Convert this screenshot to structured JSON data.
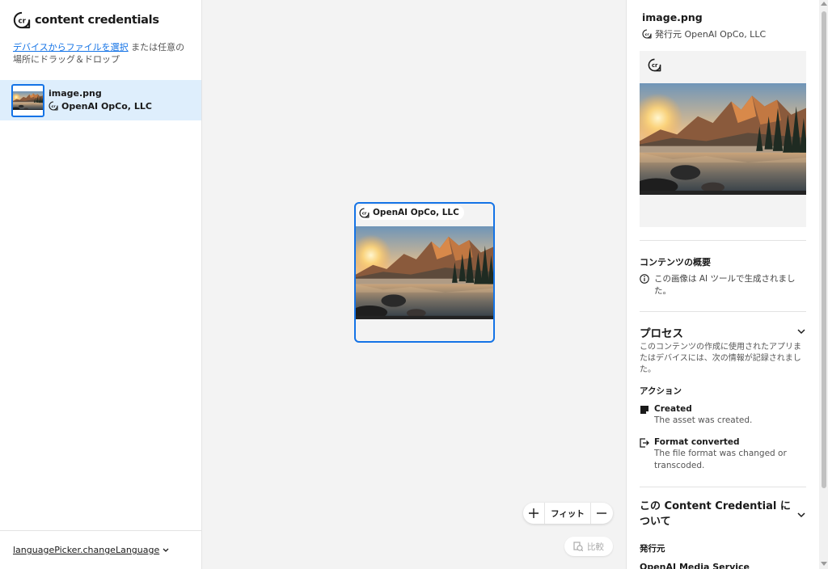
{
  "app": {
    "logo_text": "content credentials"
  },
  "sidebar": {
    "intro_link": "デバイスからファイルを選択",
    "intro_rest": " または任意の場所にドラッグ＆ドロップ",
    "file": {
      "name": "image.png",
      "issuer": "OpenAI OpCo, LLC"
    },
    "language_button": "languagePicker.changeLanguage"
  },
  "canvas": {
    "card_label": "OpenAI OpCo, LLC",
    "zoom_in": "+",
    "fit_label": "フィット",
    "zoom_out": "—",
    "compare_label": "比較"
  },
  "panel": {
    "title": "image.png",
    "issuer_line": "発行元 OpenAI OpCo, LLC",
    "summary_heading": "コンテンツの概要",
    "summary_text": "この画像は AI ツールで生成されました。",
    "process_heading": "プロセス",
    "process_desc": "このコンテンツの作成に使用されたアプリまたはデバイスには、次の情報が記録されました。",
    "actions_heading": "アクション",
    "actions": [
      {
        "title": "Created",
        "desc": "The asset was created."
      },
      {
        "title": "Format converted",
        "desc": "The file format was changed or transcoded."
      }
    ],
    "about_heading": "この Content Credential について",
    "issuer_heading": "発行元",
    "issuer_value": "OpenAI Media Service"
  },
  "colors": {
    "accent": "#1473e6",
    "selected_row": "#deeefc",
    "canvas_bg": "#f3f3f3"
  },
  "icons": [
    "cr-icon",
    "info-icon",
    "created-icon",
    "format-converted-icon",
    "chevron-down-icon",
    "compare-icon",
    "plus-icon",
    "minus-icon"
  ]
}
